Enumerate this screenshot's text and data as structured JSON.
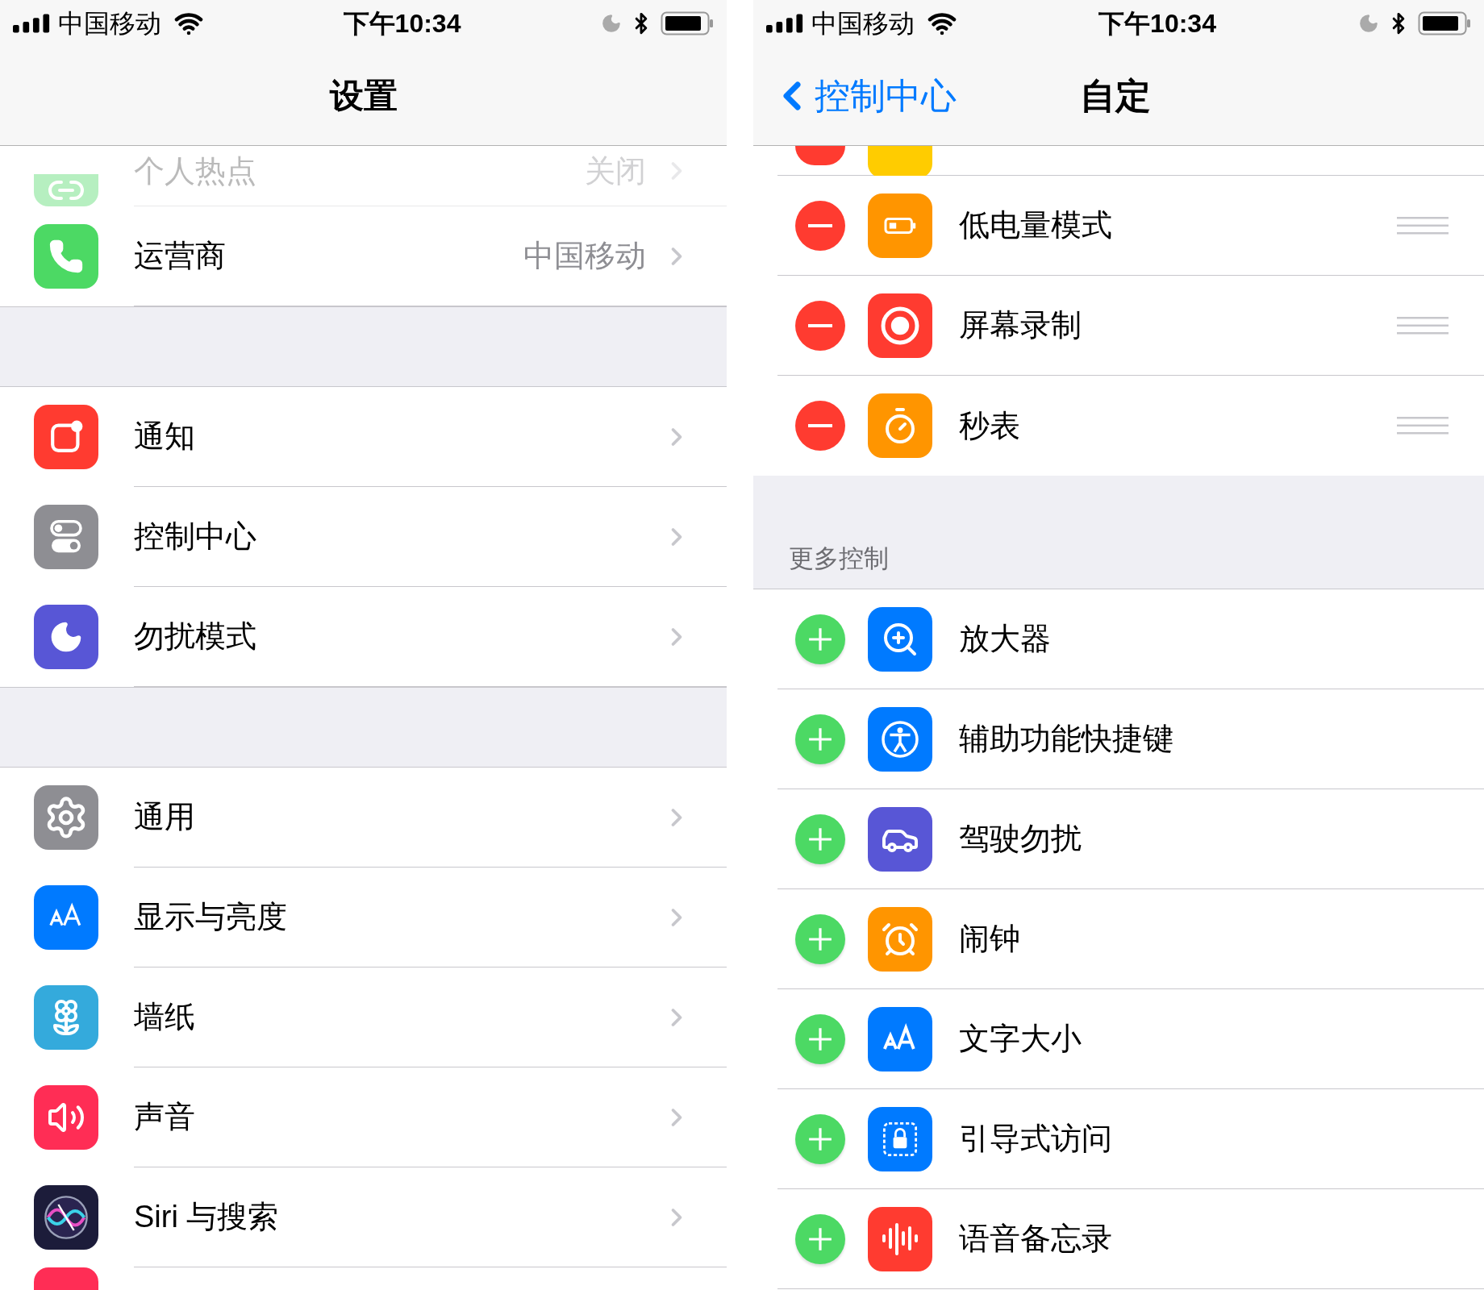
{
  "settings": {
    "status_bar": {
      "carrier": "中国移动",
      "time": "下午10:34"
    },
    "nav": {
      "title": "设置"
    },
    "groups": [
      [
        {
          "label": "个人热点",
          "value": "关闭"
        },
        {
          "label": "运营商",
          "value": "中国移动"
        }
      ],
      [
        {
          "label": "通知"
        },
        {
          "label": "控制中心"
        },
        {
          "label": "勿扰模式"
        }
      ],
      [
        {
          "label": "通用"
        },
        {
          "label": "显示与亮度"
        },
        {
          "label": "墙纸"
        },
        {
          "label": "声音"
        },
        {
          "label": "Siri 与搜索"
        }
      ]
    ]
  },
  "customize": {
    "status_bar": {
      "carrier": "中国移动",
      "time": "下午10:34"
    },
    "nav": {
      "back": "控制中心",
      "title": "自定"
    },
    "included": [
      {
        "label": "低电量模式"
      },
      {
        "label": "屏幕录制"
      },
      {
        "label": "秒表"
      }
    ],
    "more_header": "更多控制",
    "more": [
      {
        "label": "放大器"
      },
      {
        "label": "辅助功能快捷键"
      },
      {
        "label": "驾驶勿扰"
      },
      {
        "label": "闹钟"
      },
      {
        "label": "文字大小"
      },
      {
        "label": "引导式访问"
      },
      {
        "label": "语音备忘录"
      }
    ]
  }
}
